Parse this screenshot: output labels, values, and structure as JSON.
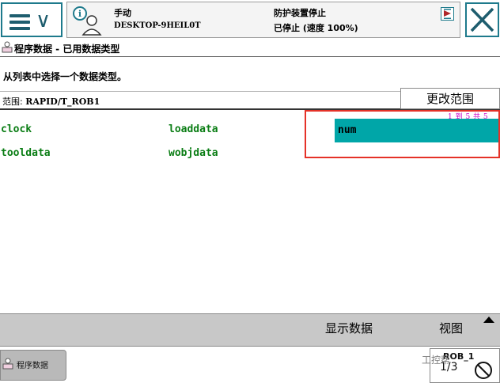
{
  "header": {
    "mode": "手动",
    "host": "DESKTOP-9HEIL0T",
    "safety_status": "防护装置停止",
    "run_status": "已停止 (速度 100%)"
  },
  "page": {
    "title": "程序数据 - 已用数据类型",
    "instruction": "从列表中选择一个数据类型。",
    "scope_label": "范围:",
    "scope_value": "RAPID/T_ROB1",
    "change_scope_label": "更改范围",
    "pager": "1 到 5 共 5"
  },
  "data_types": [
    "clock",
    "loaddata",
    "num",
    "tooldata",
    "wobjdata"
  ],
  "selected": "num",
  "toolbar": {
    "show_data_label": "显示数据",
    "view_label": "视图"
  },
  "taskbar": {
    "task_label": "程序数据",
    "rob_label": "ROB_1",
    "rob_fraction": "1/3"
  },
  "watermark": "工控帮",
  "colors": {
    "selected_bg": "#00a6a8",
    "datatype_text": "#0a7d14",
    "highlight_border": "#e53228",
    "toolbar_bg": "#c8c8c8",
    "frame_teal": "#1e7a8c"
  }
}
